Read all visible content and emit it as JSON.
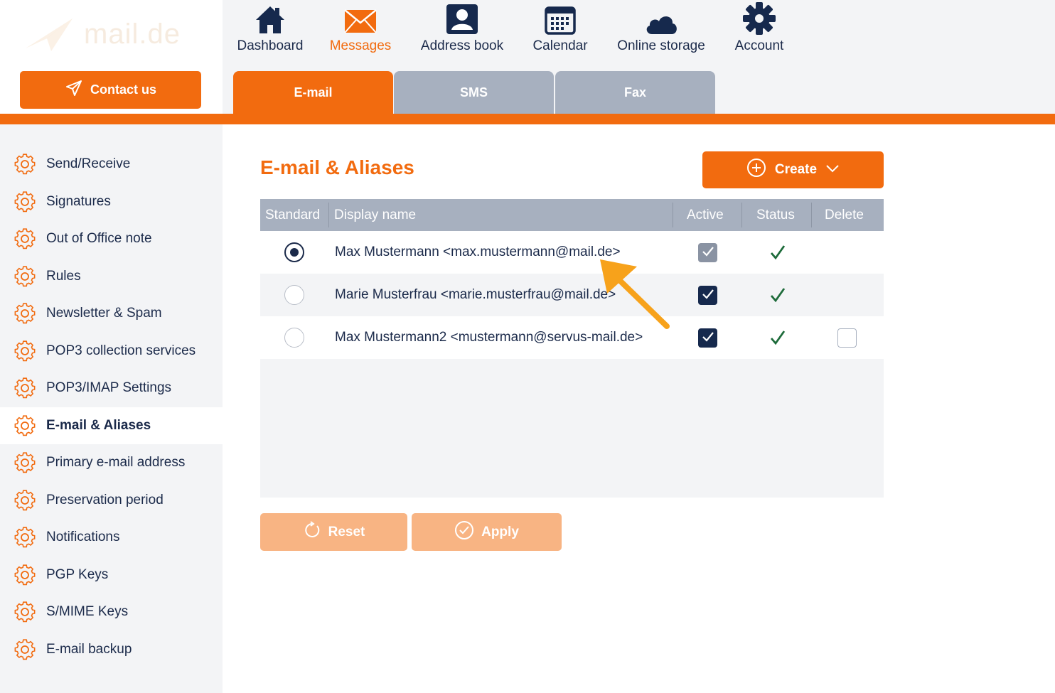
{
  "brand": {
    "logo_text": "mail.de",
    "accent": "#f26b0f",
    "navy": "#1b2a4a"
  },
  "contact_button": {
    "label": "Contact us",
    "icon": "paper-plane-icon"
  },
  "topnav": [
    {
      "label": "Dashboard",
      "icon": "home-icon",
      "active": false
    },
    {
      "label": "Messages",
      "icon": "envelope-icon",
      "active": true
    },
    {
      "label": "Address book",
      "icon": "contact-card-icon",
      "active": false
    },
    {
      "label": "Calendar",
      "icon": "calendar-icon",
      "active": false
    },
    {
      "label": "Online storage",
      "icon": "cloud-icon",
      "active": false
    },
    {
      "label": "Account",
      "icon": "gear-icon",
      "active": false
    }
  ],
  "subtabs": [
    {
      "label": "E-mail",
      "active": true
    },
    {
      "label": "SMS",
      "active": false
    },
    {
      "label": "Fax",
      "active": false
    }
  ],
  "sidebar": {
    "items": [
      {
        "label": "Send/Receive",
        "active": false
      },
      {
        "label": "Signatures",
        "active": false
      },
      {
        "label": "Out of Office note",
        "active": false
      },
      {
        "label": "Rules",
        "active": false
      },
      {
        "label": "Newsletter & Spam",
        "active": false
      },
      {
        "label": "POP3 collection services",
        "active": false
      },
      {
        "label": "POP3/IMAP Settings",
        "active": false
      },
      {
        "label": "E-mail & Aliases",
        "active": true
      },
      {
        "label": "Primary e-mail address",
        "active": false
      },
      {
        "label": "Preservation period",
        "active": false
      },
      {
        "label": "Notifications",
        "active": false
      },
      {
        "label": "PGP Keys",
        "active": false
      },
      {
        "label": "S/MIME Keys",
        "active": false
      },
      {
        "label": "E-mail backup",
        "active": false
      }
    ]
  },
  "main": {
    "title": "E-mail & Aliases",
    "create_button": {
      "label": "Create",
      "icon": "plus-circle-icon"
    },
    "table": {
      "headers": {
        "standard": "Standard",
        "display_name": "Display name",
        "active": "Active",
        "status": "Status",
        "delete": "Delete"
      },
      "rows": [
        {
          "standard": true,
          "display_name": "Max Mustermann <max.mustermann@mail.de>",
          "active": true,
          "active_disabled": true,
          "status": "ok",
          "deletable": false
        },
        {
          "standard": false,
          "display_name": "Marie Musterfrau <marie.musterfrau@mail.de>",
          "active": true,
          "active_disabled": false,
          "status": "ok",
          "deletable": false
        },
        {
          "standard": false,
          "display_name": "Max Mustermann2 <mustermann@servus-mail.de>",
          "active": true,
          "active_disabled": false,
          "status": "ok",
          "deletable": true,
          "delete_checked": false
        }
      ]
    },
    "reset_button": {
      "label": "Reset",
      "icon": "refresh-icon"
    },
    "apply_button": {
      "label": "Apply",
      "icon": "check-circle-icon"
    }
  }
}
